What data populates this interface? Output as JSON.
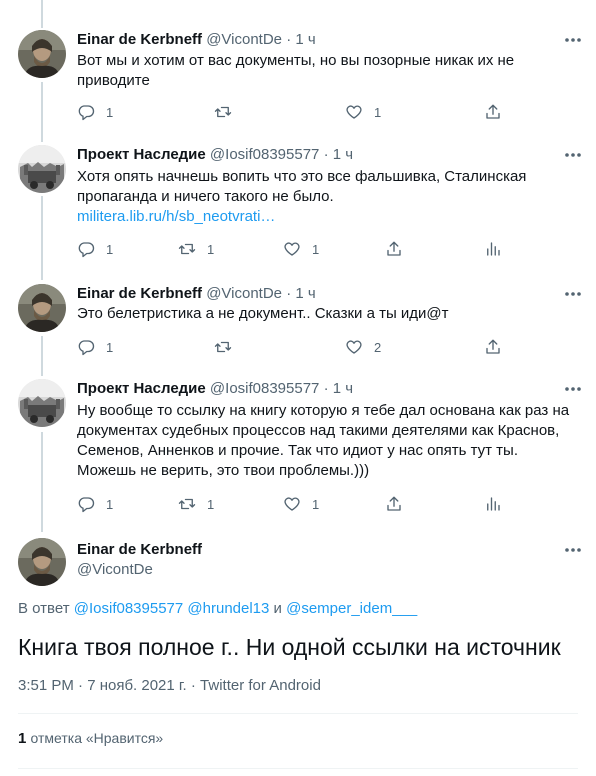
{
  "tweets": [
    {
      "name": "Einar de Kerbneff",
      "handle": "@VicontDe",
      "sep": "·",
      "time": "1 ч",
      "text": "Вот мы и хотим от вас документы, но вы позорные никак их не приводите",
      "replies": "1",
      "retweets": "",
      "likes": "1"
    },
    {
      "name": "Проект Наследие",
      "handle": "@Iosif08395577",
      "sep": "·",
      "time": "1 ч",
      "text": "Хотя опять начнешь вопить что это все фальшивка, Сталинская пропаганда и ничего такого не было.",
      "link": "militera.lib.ru/h/sb_neotvrati…",
      "replies": "1",
      "retweets": "1",
      "likes": "1"
    },
    {
      "name": "Einar de Kerbneff",
      "handle": "@VicontDe",
      "sep": "·",
      "time": "1 ч",
      "text": "Это белетристика а не документ.. Сказки а ты иди@т",
      "replies": "1",
      "retweets": "",
      "likes": "2"
    },
    {
      "name": "Проект Наследие",
      "handle": "@Iosif08395577",
      "sep": "·",
      "time": "1 ч",
      "text": "Ну вообще то ссылку на книгу которую я тебе дал основана как раз на документах судебных процессов над такими деятелями как Краснов, Семенов, Анненков и прочие. Так что идиот у нас опять тут ты. Можешь не верить, это твои проблемы.)))",
      "replies": "1",
      "retweets": "1",
      "likes": "1"
    }
  ],
  "focused": {
    "name": "Einar de Kerbneff",
    "handle": "@VicontDe",
    "reply_prefix": "В ответ",
    "reply_user1": "@Iosif08395577",
    "reply_user2": "@hrundel13",
    "reply_and": "и",
    "reply_user3": "@semper_idem___",
    "text": "Книга твоя полное г.. Ни одной ссылки на источник",
    "timestamp": "3:51 PM · 7 нояб. 2021 г. · Twitter for Android",
    "likes_count": "1",
    "likes_label": "отметка «Нравится»"
  },
  "colors": {
    "link": "#1d9bf0",
    "secondary": "#536471",
    "line": "#cfd9de"
  }
}
